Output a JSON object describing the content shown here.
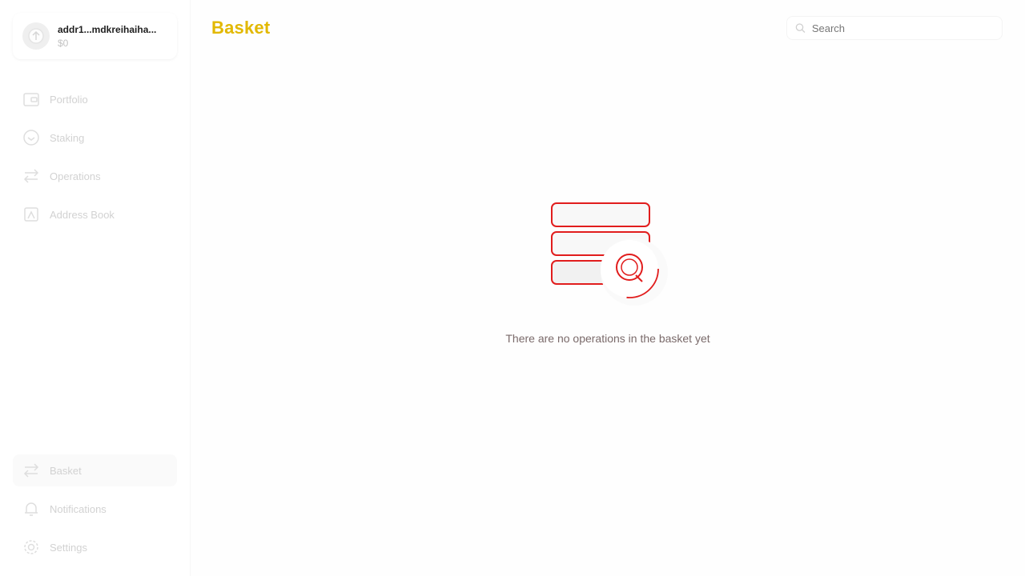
{
  "wallet": {
    "address": "addr1...mdkreihaiha...",
    "balance": "$0"
  },
  "nav": {
    "items": [
      {
        "label": "Portfolio",
        "icon": "portfolio-icon"
      },
      {
        "label": "Staking",
        "icon": "staking-icon"
      },
      {
        "label": "Operations",
        "icon": "operations-icon"
      },
      {
        "label": "Address Book",
        "icon": "address-book-icon"
      }
    ],
    "bottom": [
      {
        "label": "Basket",
        "icon": "basket-icon"
      },
      {
        "label": "Notifications",
        "icon": "bell-icon"
      },
      {
        "label": "Settings",
        "icon": "gear-icon"
      }
    ]
  },
  "header": {
    "title": "Basket",
    "search_placeholder": "Search"
  },
  "empty_state": {
    "message": "There are no operations in the basket yet"
  },
  "colors": {
    "title": "#e2b800",
    "icon_gray": "#dedede",
    "accent_red": "#e11d1d"
  }
}
